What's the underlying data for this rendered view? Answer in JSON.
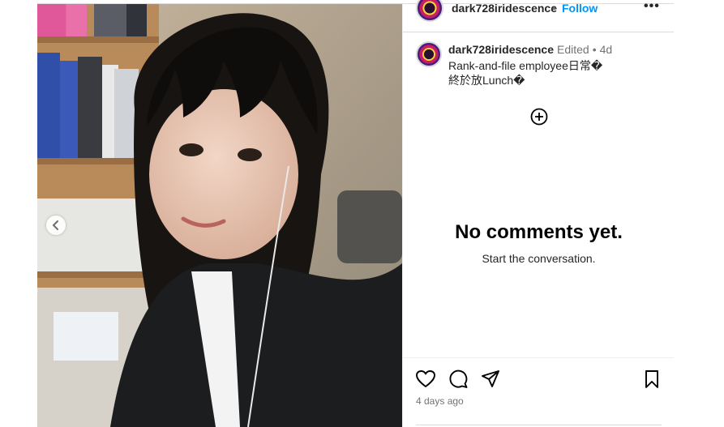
{
  "post": {
    "username": "dark728iridescence",
    "follow_label": "Follow",
    "dot": "•",
    "more_label": "•••",
    "edited_label": "Edited",
    "separator": "•",
    "age": "4d",
    "caption_line1": "Rank-and-file employee日常�",
    "caption_line2": "終於放Lunch�"
  },
  "comments": {
    "empty_title": "No comments yet.",
    "empty_subtitle": "Start the conversation."
  },
  "footer": {
    "timestamp": "4 days ago"
  },
  "icons": {
    "header_avatar": "avatar-icon",
    "prev": "chevron-left-icon",
    "add": "plus-circle-icon",
    "like": "heart-icon",
    "comment": "comment-icon",
    "share": "paper-plane-icon",
    "save": "bookmark-icon"
  },
  "colors": {
    "follow": "#0095f6",
    "muted": "#737373",
    "border": "#dbdbdb"
  }
}
